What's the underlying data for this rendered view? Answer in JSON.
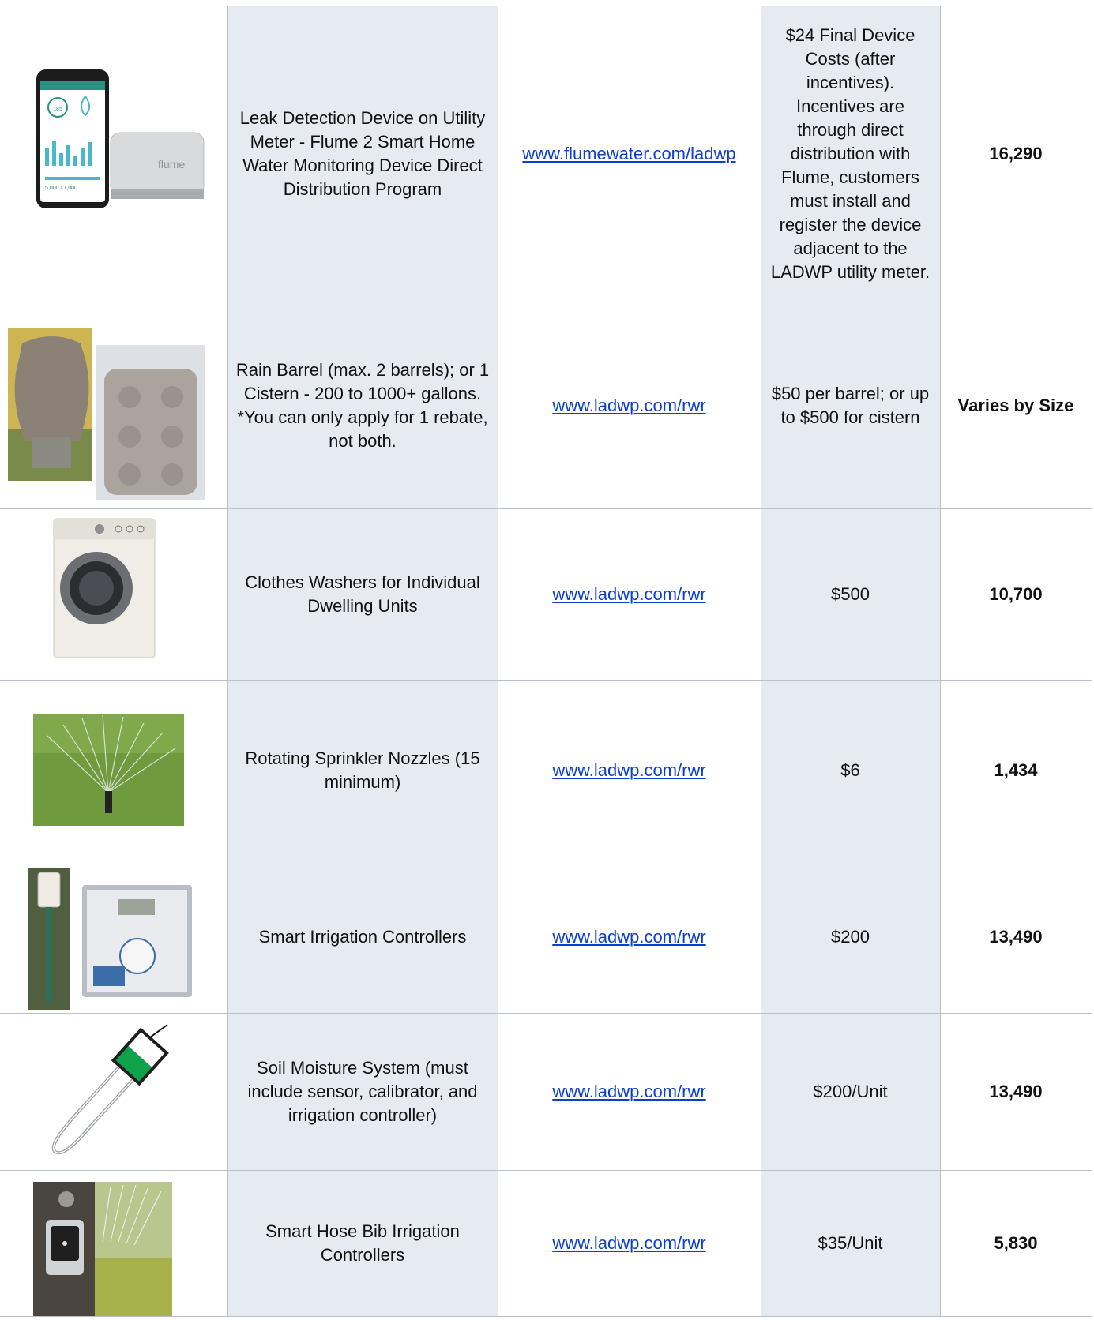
{
  "rows": [
    {
      "image": "flume-smart-meter-and-phone-app",
      "phone_label_1": "185",
      "phone_label_2": "5,000 / 7,000",
      "device_brand": "flume",
      "description": "Leak Detection Device on Utility Meter - Flume 2 Smart Home Water Monitoring Device Direct Distribution Program",
      "link": "www.flumewater.com/ladwp",
      "rebate": "$24 Final Device Costs (after incentives). Incentives are through direct distribution with Flume, customers must install and register the device adjacent to the LADWP utility meter.",
      "savings": "16,290"
    },
    {
      "image": "rain-barrel-and-cistern",
      "description": "Rain Barrel (max. 2 barrels); or 1 Cistern - 200 to 1000+ gallons. *You can only apply for 1 rebate, not both.",
      "link": "www.ladwp.com/rwr",
      "rebate": "$50 per barrel; or up to $500 for cistern",
      "savings": "Varies by Size"
    },
    {
      "image": "clothes-washer",
      "description": "Clothes Washers for Individual Dwelling Units",
      "link": "www.ladwp.com/rwr",
      "rebate": "$500",
      "savings": "10,700"
    },
    {
      "image": "rotating-sprinkler-nozzle",
      "description": "Rotating Sprinkler Nozzles (15 minimum)",
      "link": "www.ladwp.com/rwr",
      "rebate": "$6",
      "savings": "1,434"
    },
    {
      "image": "smart-irrigation-controller",
      "description": "Smart Irrigation Controllers",
      "link": "www.ladwp.com/rwr",
      "rebate": "$200",
      "savings": "13,490"
    },
    {
      "image": "soil-moisture-sensor",
      "description": "Soil Moisture System (must include sensor, calibrator, and irrigation controller)",
      "link": "www.ladwp.com/rwr",
      "rebate": "$200/Unit",
      "savings": "13,490"
    },
    {
      "image": "smart-hose-bib-controller",
      "description": "Smart Hose Bib Irrigation Controllers",
      "link": "www.ladwp.com/rwr",
      "rebate": "$35/Unit",
      "savings": "5,830"
    }
  ]
}
